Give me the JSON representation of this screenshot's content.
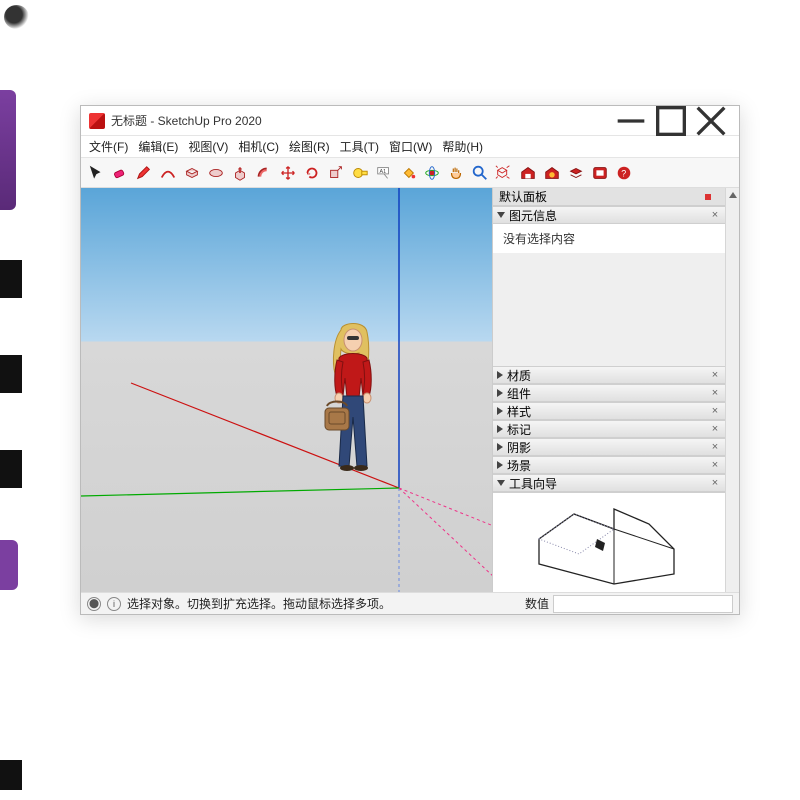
{
  "titlebar": {
    "title": "无标题 - SketchUp Pro 2020"
  },
  "menubar": {
    "file": "文件(F)",
    "edit": "编辑(E)",
    "view": "视图(V)",
    "camera": "相机(C)",
    "draw": "绘图(R)",
    "tools": "工具(T)",
    "window": "窗口(W)",
    "help": "帮助(H)"
  },
  "toolbar_icons": [
    "select-arrow",
    "eraser",
    "pencil",
    "arc",
    "rectangle",
    "circle",
    "push-pull",
    "offset",
    "move",
    "rotate",
    "scale",
    "tape-measure",
    "text-label",
    "paint-bucket",
    "orbit",
    "pan",
    "zoom",
    "zoom-extents",
    "warehouse",
    "extension-warehouse",
    "layers",
    "help-question"
  ],
  "panels": {
    "tray_title": "默认面板",
    "entity_info": {
      "title": "图元信息",
      "content": "没有选择内容"
    },
    "materials": "材质",
    "components": "组件",
    "styles": "样式",
    "tags": "标记",
    "shadows": "阴影",
    "scenes": "场景",
    "instructor": "工具向导"
  },
  "statusbar": {
    "hint": "选择对象。切换到扩充选择。拖动鼠标选择多项。",
    "value_label": "数值"
  }
}
